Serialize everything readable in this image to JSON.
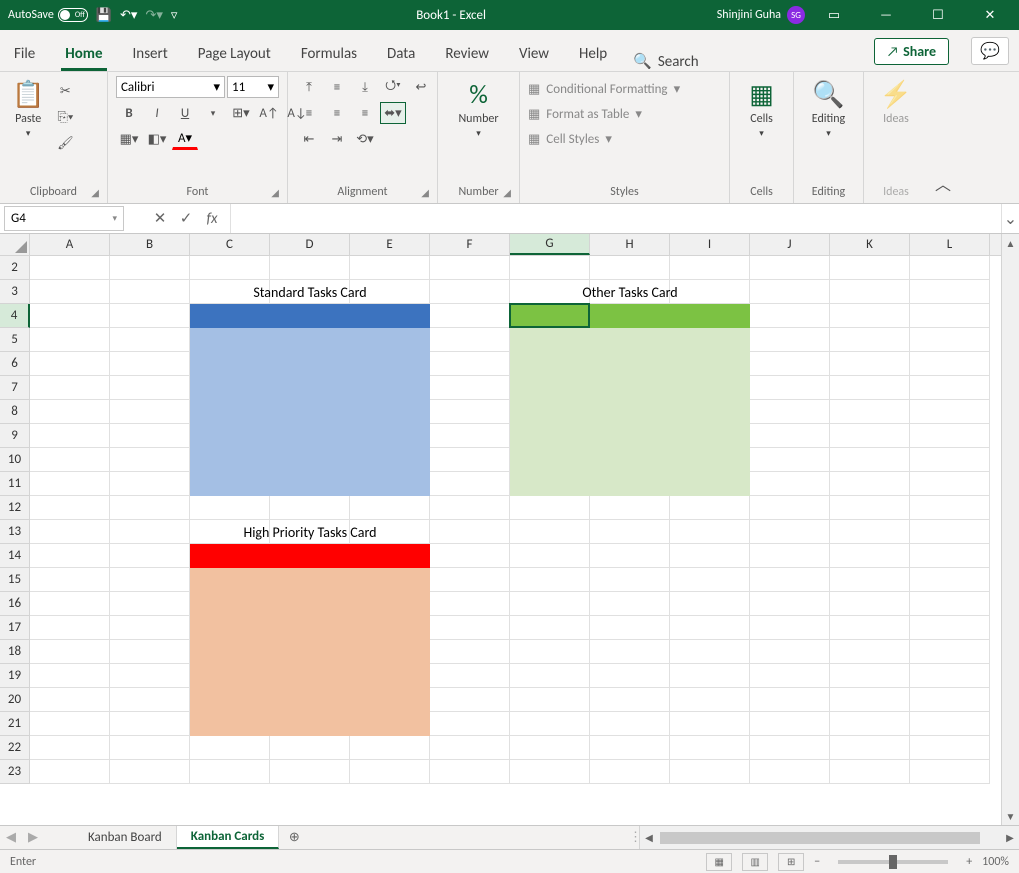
{
  "titlebar": {
    "autosave_label": "AutoSave",
    "autosave_state": "Off",
    "doc_title": "Book1  -  Excel",
    "user_name": "Shinjini Guha",
    "user_initials": "SG"
  },
  "tabs": {
    "file": "File",
    "home": "Home",
    "insert": "Insert",
    "page_layout": "Page Layout",
    "formulas": "Formulas",
    "data": "Data",
    "review": "Review",
    "view": "View",
    "help": "Help",
    "search": "Search",
    "share": "Share"
  },
  "ribbon": {
    "clipboard": {
      "paste": "Paste",
      "label": "Clipboard"
    },
    "font": {
      "name": "Calibri",
      "size": "11",
      "bold": "B",
      "italic": "I",
      "underline": "U",
      "label": "Font"
    },
    "alignment": {
      "label": "Alignment"
    },
    "number": {
      "btn": "Number",
      "symbol": "%",
      "label": "Number"
    },
    "styles": {
      "cond_fmt": "Conditional Formatting",
      "as_table": "Format as Table",
      "cell_styles": "Cell Styles",
      "label": "Styles"
    },
    "cells": {
      "btn": "Cells",
      "label": "Cells"
    },
    "editing": {
      "btn": "Editing",
      "label": "Editing"
    },
    "ideas": {
      "btn": "Ideas",
      "label": "Ideas"
    }
  },
  "formula_bar": {
    "name_box": "G4",
    "formula": ""
  },
  "grid": {
    "columns": [
      "A",
      "B",
      "C",
      "D",
      "E",
      "F",
      "G",
      "H",
      "I",
      "J",
      "K",
      "L"
    ],
    "row_start": 2,
    "row_end": 23,
    "selected_cell": "G4",
    "cards": {
      "standard": {
        "title": "Standard Tasks Card",
        "head_color": "#3c73bf",
        "body_color": "#a4bfe4",
        "col_start": 2,
        "col_end": 4,
        "title_row": 3,
        "head_row": 4,
        "body_rows": 7
      },
      "other": {
        "title": "Other Tasks Card",
        "head_color": "#7cc243",
        "body_color": "#d7e8c8",
        "col_start": 6,
        "col_end": 8,
        "title_row": 3,
        "head_row": 4,
        "body_rows": 7
      },
      "priority": {
        "title": "High Priority Tasks Card",
        "head_color": "#ff0000",
        "body_color": "#f2c1a0",
        "col_start": 2,
        "col_end": 4,
        "title_row": 13,
        "head_row": 14,
        "body_rows": 7
      }
    }
  },
  "sheet_tabs": {
    "tab1": "Kanban Board",
    "tab2": "Kanban Cards"
  },
  "status": {
    "mode": "Enter",
    "zoom": "100%"
  }
}
